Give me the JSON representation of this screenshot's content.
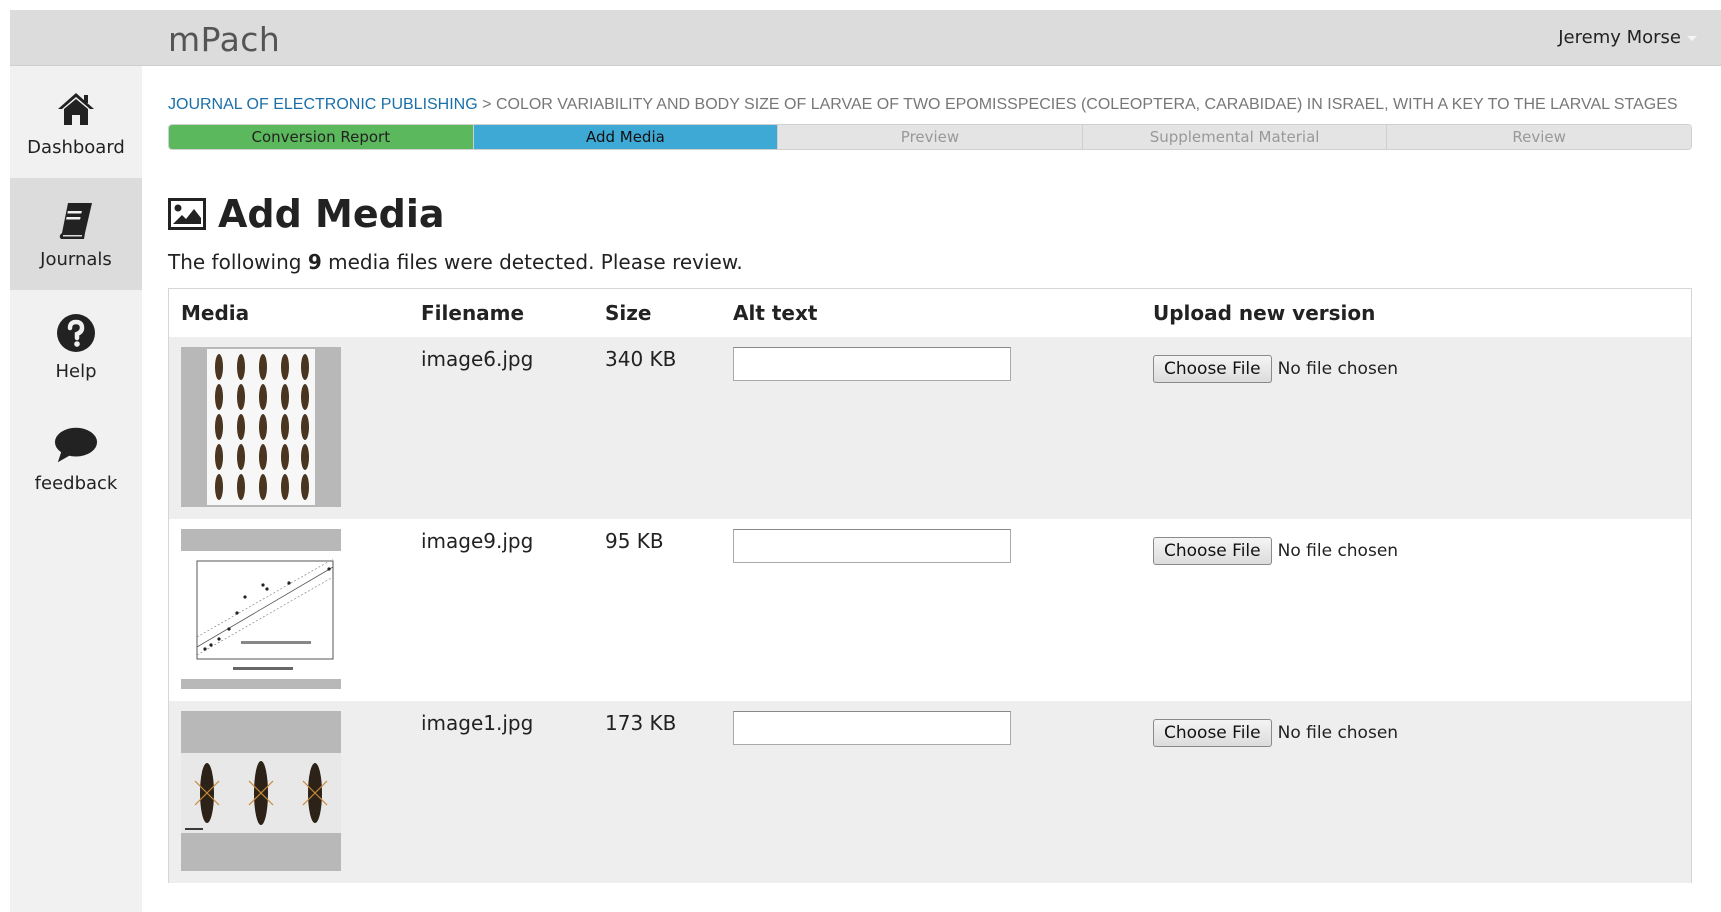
{
  "app": {
    "brand": "mPach",
    "user": "Jeremy Morse"
  },
  "sidebar": {
    "items": [
      {
        "label": "Dashboard",
        "icon": "home-icon",
        "active": false
      },
      {
        "label": "Journals",
        "icon": "book-icon",
        "active": true
      },
      {
        "label": "Help",
        "icon": "question-icon",
        "active": false
      },
      {
        "label": "feedback",
        "icon": "speech-bubble-icon",
        "active": false
      }
    ]
  },
  "breadcrumb": {
    "journal": "Journal of Electronic Publishing",
    "separator": ">",
    "article": "Color variability and body size of larvae of two Epomisspecies (Coleoptera, Carabidae) in Israel, with a key to the larval stages"
  },
  "steps": [
    {
      "label": "Conversion Report",
      "state": "done"
    },
    {
      "label": "Add Media",
      "state": "current"
    },
    {
      "label": "Preview",
      "state": "pending"
    },
    {
      "label": "Supplemental Material",
      "state": "pending"
    },
    {
      "label": "Review",
      "state": "pending"
    }
  ],
  "page": {
    "title": "Add Media",
    "title_icon": "image-icon",
    "intro_before": "The following ",
    "intro_count": "9",
    "intro_after": " media files were detected. Please review."
  },
  "table": {
    "headers": {
      "media": "Media",
      "filename": "Filename",
      "size": "Size",
      "alt": "Alt text",
      "upload": "Upload new version"
    },
    "rows": [
      {
        "filename": "image6.jpg",
        "size": "340 KB",
        "alt": "",
        "thumb": "larvae-grid-thumbnail"
      },
      {
        "filename": "image9.jpg",
        "size": "95 KB",
        "alt": "",
        "thumb": "scatter-plot-thumbnail"
      },
      {
        "filename": "image1.jpg",
        "size": "173 KB",
        "alt": "",
        "thumb": "three-larvae-thumbnail"
      }
    ],
    "choose_label": "Choose File",
    "no_file_label": "No file chosen"
  },
  "colors": {
    "done": "#5cb85c",
    "current": "#3fa9d6",
    "link": "#1b6fa8",
    "topbar": "#dcdcdc"
  }
}
